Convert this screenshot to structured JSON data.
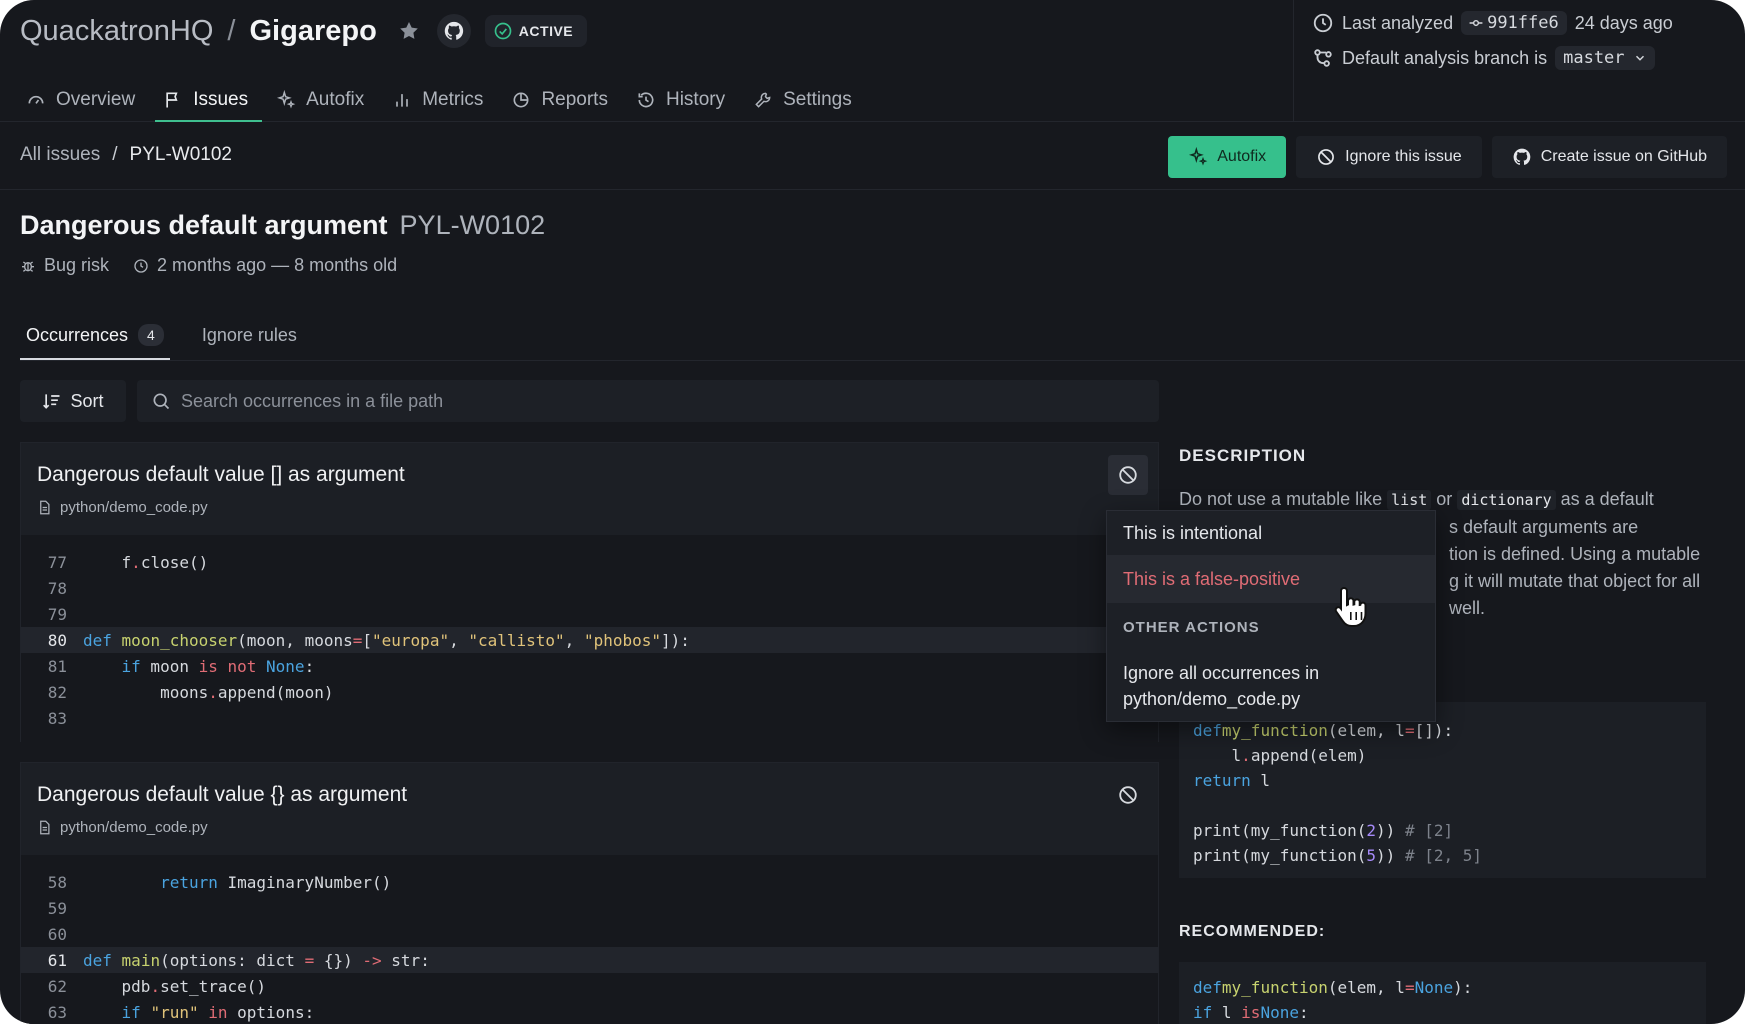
{
  "repo": {
    "owner": "QuackatronHQ",
    "separator": "/",
    "name": "Gigarepo",
    "status": "ACTIVE"
  },
  "nav": [
    {
      "label": "Overview",
      "icon": "gauge-icon"
    },
    {
      "label": "Issues",
      "icon": "flag-icon",
      "active": true
    },
    {
      "label": "Autofix",
      "icon": "sparkle-icon"
    },
    {
      "label": "Metrics",
      "icon": "bar-chart-icon"
    },
    {
      "label": "Reports",
      "icon": "pie-chart-icon"
    },
    {
      "label": "History",
      "icon": "history-icon"
    },
    {
      "label": "Settings",
      "icon": "wrench-icon"
    }
  ],
  "analysis": {
    "last_analyzed_label": "Last analyzed",
    "commit": "991ffe6",
    "ago": "24 days ago",
    "branch_label": "Default analysis branch is",
    "branch": "master"
  },
  "breadcrumb": {
    "all": "All issues",
    "sep": "/",
    "current": "PYL-W0102"
  },
  "actions": {
    "autofix": "Autofix",
    "ignore": "Ignore this issue",
    "github": "Create issue on GitHub"
  },
  "issue": {
    "title": "Dangerous default argument",
    "code": "PYL-W0102",
    "category": "Bug risk",
    "age": "2 months ago — 8 months old"
  },
  "tabs": {
    "occurrences": "Occurrences",
    "count": "4",
    "ignore_rules": "Ignore rules"
  },
  "sort_label": "Sort",
  "search_placeholder": "Search occurrences in a file path",
  "occurrences": [
    {
      "title": "Dangerous default value [] as argument",
      "file": "python/demo_code.py",
      "lines": [
        "77",
        "78",
        "79",
        "80",
        "81",
        "82",
        "83"
      ]
    },
    {
      "title": "Dangerous default value {} as argument",
      "file": "python/demo_code.py",
      "lines": [
        "58",
        "59",
        "60",
        "61",
        "62",
        "63"
      ]
    }
  ],
  "dropdown": {
    "intentional": "This is intentional",
    "false_positive": "This is a false-positive",
    "section": "OTHER ACTIONS",
    "ignore_all_1": "Ignore all occurrences in",
    "ignore_all_2": "python/demo_code.py"
  },
  "description": {
    "heading": "DESCRIPTION",
    "p1": "Do not use a mutable like",
    "c1": "list",
    "p2": "or",
    "c2": "dictionary",
    "p3": "as a default",
    "line2": "s default arguments are",
    "line3": "tion is defined. Using a mutable",
    "line4": "g it will mutate that object for all",
    "line5": "well."
  },
  "recommended_heading": "RECOMMENDED:",
  "colors": {
    "accent": "#36c08c",
    "danger": "#e06c75",
    "bg": "#16181d"
  }
}
